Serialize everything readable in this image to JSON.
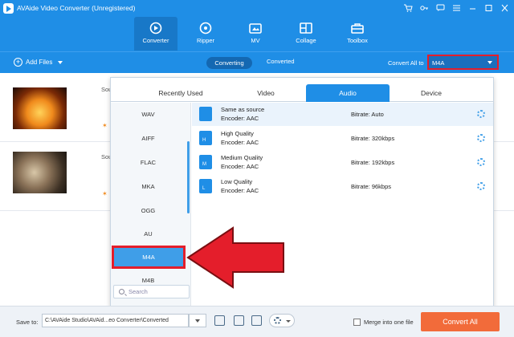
{
  "app": {
    "title": "AVAide Video Converter (Unregistered)"
  },
  "window_controls": [
    "cart-icon",
    "key-icon",
    "chat-icon",
    "menu-icon",
    "minimize-icon",
    "maximize-icon",
    "close-icon"
  ],
  "nav": {
    "items": [
      {
        "label": "Converter",
        "icon": "converter-icon",
        "active": true
      },
      {
        "label": "Ripper",
        "icon": "disc-icon",
        "active": false
      },
      {
        "label": "MV",
        "icon": "mv-icon",
        "active": false
      },
      {
        "label": "Collage",
        "icon": "collage-icon",
        "active": false
      },
      {
        "label": "Toolbox",
        "icon": "toolbox-icon",
        "active": false
      }
    ]
  },
  "subbar": {
    "add_files": "Add Files",
    "converting": "Converting",
    "converted": "Converted",
    "convert_all_to": "Convert All to",
    "format_selected": "M4A"
  },
  "files": [
    {
      "source_prefix": "Sou"
    },
    {
      "source_prefix": "Sou"
    }
  ],
  "dropdown": {
    "tabs": [
      "Recently Used",
      "Video",
      "Audio",
      "Device"
    ],
    "active_tab": "Audio",
    "formats": [
      "WAV",
      "AIFF",
      "FLAC",
      "MKA",
      "OGG",
      "AU",
      "M4A",
      "M4B"
    ],
    "selected_format": "M4A",
    "search_placeholder": "Search",
    "qualities": [
      {
        "name": "Same as source",
        "encoder": "Encoder: AAC",
        "bitrate": "Bitrate: Auto",
        "badge": ""
      },
      {
        "name": "High Quality",
        "encoder": "Encoder: AAC",
        "bitrate": "Bitrate: 320kbps",
        "badge": "H"
      },
      {
        "name": "Medium Quality",
        "encoder": "Encoder: AAC",
        "bitrate": "Bitrate: 192kbps",
        "badge": "M"
      },
      {
        "name": "Low Quality",
        "encoder": "Encoder: AAC",
        "bitrate": "Bitrate: 96kbps",
        "badge": "L"
      }
    ]
  },
  "bottom": {
    "save_to": "Save to:",
    "path": "C:\\AVAide Studio\\AVAid...eo Converter\\Converted",
    "merge_label": "Merge into one file",
    "convert_all": "Convert All"
  },
  "colors": {
    "brand": "#1f8ee6",
    "highlight": "#e41e2b",
    "convert": "#f26b3a"
  }
}
